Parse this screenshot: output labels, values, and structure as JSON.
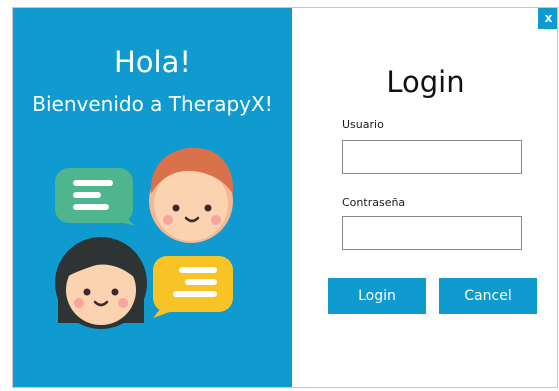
{
  "welcome_panel": {
    "greeting": "Hola!",
    "subtitle": "Bienvenido a TherapyX!",
    "background_color": "#0f9bd0",
    "illustration_icon": "chat-people-illustration"
  },
  "window": {
    "close_label": "x"
  },
  "login_form": {
    "title": "Login",
    "username_label": "Usuario",
    "username_value": "",
    "password_label": "Contraseña",
    "password_value": "",
    "login_button": "Login",
    "cancel_button": "Cancel",
    "accent_color": "#0f9bd0"
  }
}
